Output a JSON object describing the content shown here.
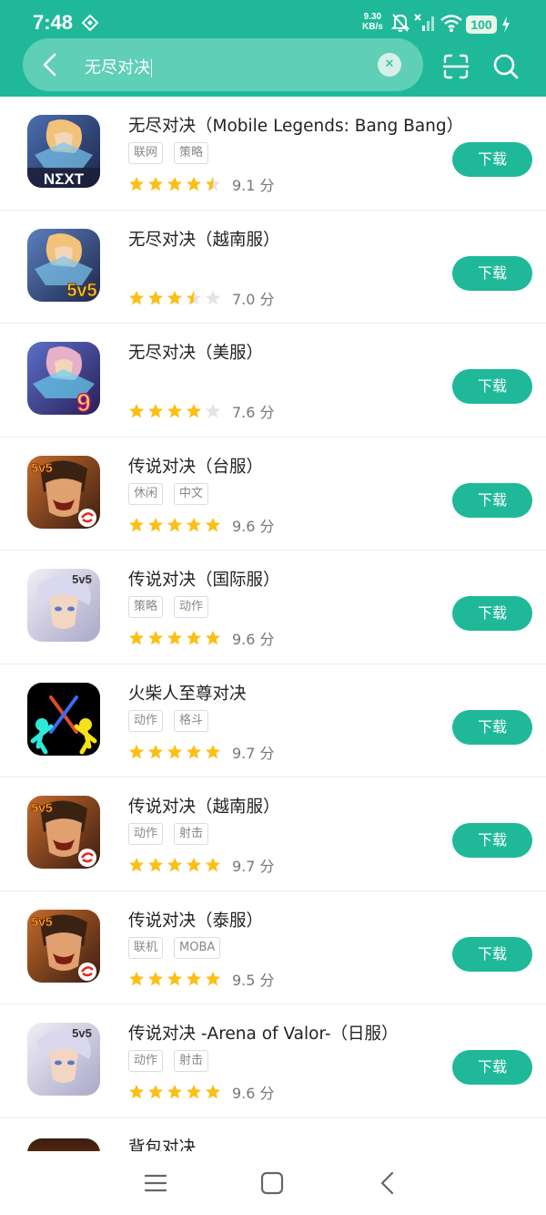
{
  "status": {
    "time": "7:48",
    "speed_value": "9.30",
    "speed_unit": "KB/s",
    "battery": "100"
  },
  "search": {
    "query": "无尽对决",
    "back_icon": "chevron-left-icon",
    "clear_icon": "close-icon",
    "scan_icon": "scan-icon",
    "search_icon": "search-icon"
  },
  "colors": {
    "brand": "#1fb99a",
    "star": "#fbbf16",
    "star_empty": "#e4e4e4"
  },
  "apps": [
    {
      "title": "无尽对决（Mobile Legends: Bang Bang）",
      "tags": [
        "联网",
        "策略"
      ],
      "rating": 4.5,
      "score": "9.1 分",
      "button": "下载",
      "icon": "mlbb-next"
    },
    {
      "title": "无尽对决（越南服）",
      "tags": [],
      "rating": 3.5,
      "score": "7.0 分",
      "button": "下载",
      "icon": "mlbb-5v5"
    },
    {
      "title": "无尽对决（美服）",
      "tags": [],
      "rating": 4,
      "score": "7.6 分",
      "button": "下载",
      "icon": "mlbb-9"
    },
    {
      "title": "传说对决（台服）",
      "tags": [
        "休闲",
        "中文"
      ],
      "rating": 5,
      "score": "9.6 分",
      "button": "下载",
      "icon": "aov-garena"
    },
    {
      "title": "传说对决（国际服）",
      "tags": [
        "策略",
        "动作"
      ],
      "rating": 5,
      "score": "9.6 分",
      "button": "下载",
      "icon": "aov-white"
    },
    {
      "title": "火柴人至尊对决",
      "tags": [
        "动作",
        "格斗"
      ],
      "rating": 5,
      "score": "9.7 分",
      "button": "下载",
      "icon": "stickman"
    },
    {
      "title": "传说对决（越南服）",
      "tags": [
        "动作",
        "射击"
      ],
      "rating": 5,
      "score": "9.7 分",
      "button": "下载",
      "icon": "aov-garena"
    },
    {
      "title": "传说对决（泰服）",
      "tags": [
        "联机",
        "MOBA"
      ],
      "rating": 5,
      "score": "9.5 分",
      "button": "下载",
      "icon": "aov-garena"
    },
    {
      "title": "传说对决 -Arena of Valor-（日服）",
      "tags": [
        "动作",
        "射击"
      ],
      "rating": 5,
      "score": "9.6 分",
      "button": "下载",
      "icon": "aov-white"
    }
  ],
  "partial_app": {
    "title": "背包对决"
  },
  "nav": {
    "menu_icon": "menu-icon",
    "home_icon": "home-icon",
    "back_icon": "back-icon"
  }
}
